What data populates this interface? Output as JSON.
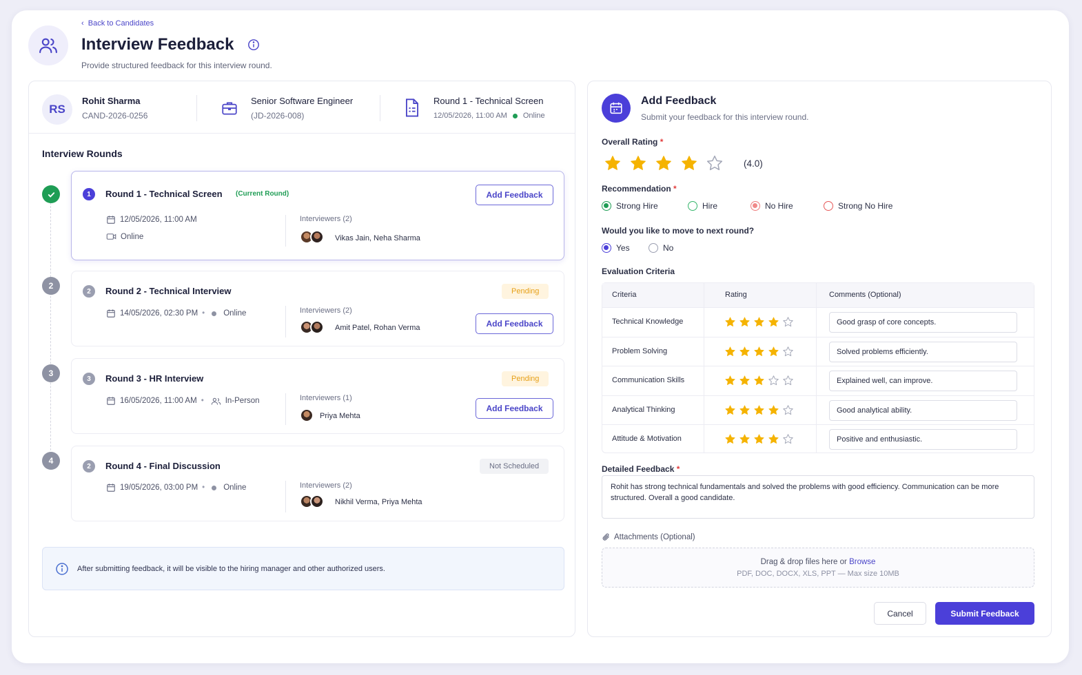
{
  "header": {
    "back_label": "Back to Candidates",
    "title": "Interview Feedback",
    "subtitle": "Provide structured feedback for this interview round."
  },
  "candidate": {
    "initials": "RS",
    "name": "Rohit Sharma",
    "id": "CAND-2026-0256",
    "job_title": "Senior Software Engineer",
    "job_id": "(JD-2026-008)",
    "round_title": "Round 1 - Technical Screen",
    "round_datetime": "12/05/2026, 11:00 AM",
    "round_mode": "Online"
  },
  "rounds_section": {
    "title": "Interview Rounds",
    "rounds": [
      {
        "timeline": "",
        "num": "1",
        "title": "Round 1 - Technical Screen",
        "current_label": "(Current Round)",
        "datetime": "12/05/2026, 11:00 AM",
        "mode": "Online",
        "interviewers_label": "Interviewers (2)",
        "interviewers": "Vikas Jain, Neha Sharma",
        "button": "Add Feedback",
        "status": ""
      },
      {
        "timeline": "2",
        "num": "2",
        "title": "Round 2 - Technical Interview",
        "datetime": "14/05/2026, 02:30 PM",
        "mode": "Online",
        "interviewers_label": "Interviewers (2)",
        "interviewers": "Amit Patel, Rohan Verma",
        "button": "Add Feedback",
        "status": "Pending"
      },
      {
        "timeline": "3",
        "num": "3",
        "title": "Round 3 - HR Interview",
        "datetime": "16/05/2026, 11:00 AM",
        "mode": "In-Person",
        "interviewers_label": "Interviewers (1)",
        "interviewers": "Priya Mehta",
        "button": "Add Feedback",
        "status": "Pending"
      },
      {
        "timeline": "4",
        "num": "2",
        "title": "Round 4 - Final Discussion",
        "datetime": "19/05/2026, 03:00 PM",
        "mode": "Online",
        "interviewers_label": "Interviewers (2)",
        "interviewers": "Nikhil Verma, Priya Mehta",
        "button": "",
        "status": "Not Scheduled"
      }
    ],
    "note": "After submitting feedback, it will be visible to the hiring manager and other authorized users."
  },
  "feedback": {
    "title": "Add Feedback",
    "subtitle": "Submit your feedback for this interview round.",
    "overall_rating_label": "Overall Rating",
    "overall_rating": 4,
    "overall_rating_text": "(4.0)",
    "recommendation_label": "Recommendation",
    "recommendation_options": [
      "Strong Hire",
      "Hire",
      "No Hire",
      "Strong No Hire"
    ],
    "recommendation_selected": "Strong Hire",
    "next_round_label": "Would you like to move to next round?",
    "next_round_options": [
      "Yes",
      "No"
    ],
    "next_round_selected": "Yes",
    "criteria_label": "Evaluation Criteria",
    "criteria_headers": [
      "Criteria",
      "Rating",
      "Comments (Optional)"
    ],
    "criteria": [
      {
        "name": "Technical Knowledge",
        "rating": 4,
        "comment": "Good grasp of core concepts."
      },
      {
        "name": "Problem Solving",
        "rating": 4,
        "comment": "Solved problems efficiently."
      },
      {
        "name": "Communication Skills",
        "rating": 3,
        "comment": "Explained well, can improve."
      },
      {
        "name": "Analytical Thinking",
        "rating": 4,
        "comment": "Good analytical ability."
      },
      {
        "name": "Attitude & Motivation",
        "rating": 4,
        "comment": "Positive and enthusiastic."
      }
    ],
    "detailed_label": "Detailed Feedback",
    "detailed_text": "Rohit has strong technical fundamentals and solved the problems with good efficiency. Communication can be more structured. Overall a good candidate.",
    "attachments_label": "Attachments (Optional)",
    "drop_text": "Drag & drop files here or",
    "browse_label": "Browse",
    "drop_hint": "PDF, DOC, DOCX, XLS, PPT — Max size 10MB",
    "cancel_label": "Cancel",
    "submit_label": "Submit Feedback"
  },
  "colors": {
    "accent": "#4b3fd9",
    "success": "#1f9d55",
    "pending": "#e6a018",
    "star": "#f5b301",
    "danger": "#e23c3c"
  }
}
